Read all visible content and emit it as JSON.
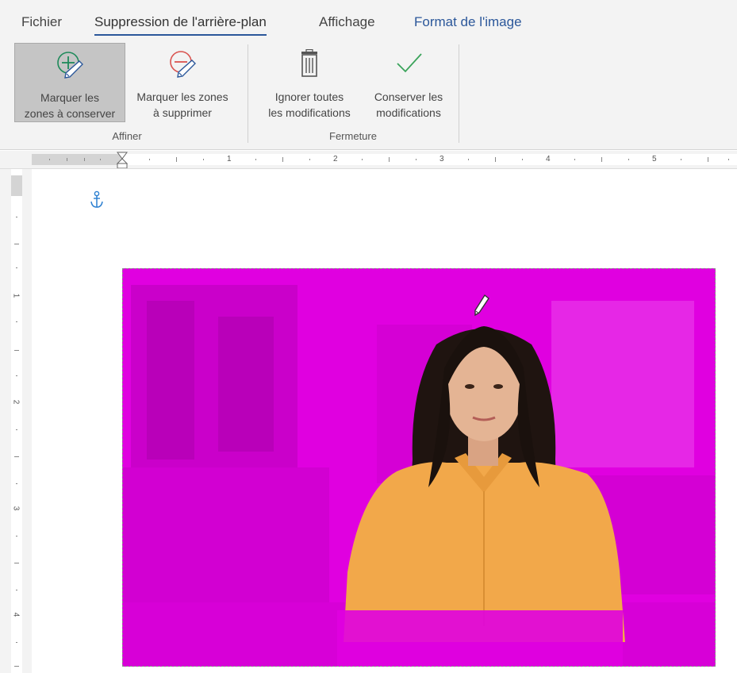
{
  "tabs": [
    {
      "label": "Fichier"
    },
    {
      "label": "Suppression de l'arrière-plan",
      "active": true
    },
    {
      "label": "Affichage"
    },
    {
      "label": "Format de l'image",
      "contextual": true
    }
  ],
  "ribbon": {
    "affiner": {
      "label": "Affiner",
      "mark_keep": {
        "line1": "Marquer les",
        "line2": "zones à conserver",
        "icon": "plus-pencil-icon",
        "color": "#1e8a5a"
      },
      "mark_remove": {
        "line1": "Marquer les zones",
        "line2": "à supprimer",
        "icon": "minus-pencil-icon",
        "color": "#d9534f"
      }
    },
    "fermeture": {
      "label": "Fermeture",
      "discard": {
        "line1": "Ignorer toutes",
        "line2": "les modifications",
        "icon": "trash-icon"
      },
      "keep": {
        "line1": "Conserver les",
        "line2": "modifications",
        "icon": "checkmark-icon",
        "color": "#3aa35a"
      }
    }
  },
  "ruler": {
    "horizontal": [
      "1",
      "2",
      "3",
      "4",
      "5"
    ],
    "vertical": [
      "1",
      "2",
      "3",
      "4"
    ]
  },
  "document": {
    "anchor_icon": "anchor-icon",
    "removal_color": "#e000e0",
    "cursor_icon": "pencil-cursor-icon"
  }
}
